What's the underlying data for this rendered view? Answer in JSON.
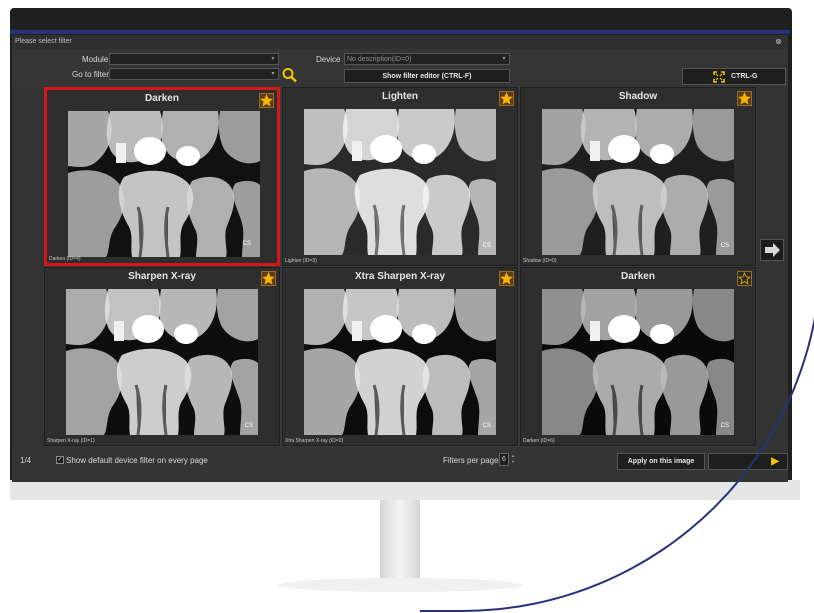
{
  "window": {
    "title": "Please select filter",
    "close": "⊗"
  },
  "toolbar": {
    "module_label": "Module",
    "module_value": "",
    "goto_label": "Go to filter",
    "goto_value": "",
    "device_label": "Device",
    "device_value": "No description(ID=0)",
    "filter_editor_button": "Show filter editor (CTRL-F)",
    "fullscreen_button": "CTRL-G"
  },
  "tiles": [
    {
      "name": "Darken",
      "caption": "Darken (ID=4)",
      "badge": "CS",
      "favorite": true,
      "selected": true
    },
    {
      "name": "Lighten",
      "caption": "Lighten (ID=3)",
      "badge": "CS",
      "favorite": true,
      "selected": false
    },
    {
      "name": "Shadow",
      "caption": "Shadow (ID=0)",
      "badge": "CS",
      "favorite": true,
      "selected": false
    },
    {
      "name": "Sharpen X-ray",
      "caption": "Sharpen X-ray (ID=1)",
      "badge": "CS",
      "favorite": true,
      "selected": false
    },
    {
      "name": "Xtra Sharpen X-ray",
      "caption": "Xtra Sharpen X-ray (ID=2)",
      "badge": "CS",
      "favorite": true,
      "selected": false
    },
    {
      "name": "Darken",
      "caption": "Darken (ID=6)",
      "badge": "CS",
      "favorite": false,
      "selected": false
    }
  ],
  "footer": {
    "page": "1/4",
    "show_default_label": "Show default device filter on every page",
    "show_default_checked": true,
    "filters_per_page_label": "Filters per page",
    "filters_per_page_value": "6",
    "apply_button": "Apply on this image"
  },
  "colors": {
    "selection": "#d51717",
    "star_fill": "#f5b400",
    "frame": "#27327a"
  },
  "icons": [
    "search-icon",
    "star-icon",
    "fullscreen-icon",
    "next-arrow-icon",
    "close-icon",
    "checkbox-icon"
  ]
}
